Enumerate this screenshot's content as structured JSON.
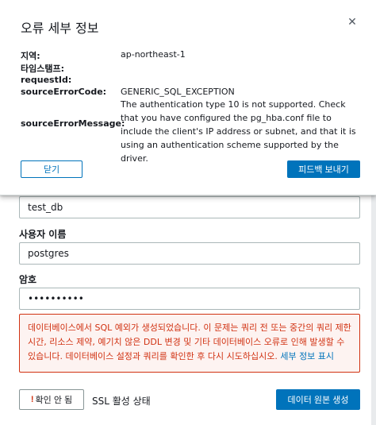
{
  "modal": {
    "title": "오류 세부 정보",
    "close_icon": "close-icon",
    "fields": [
      {
        "key": "지역:",
        "value": "ap-northeast-1"
      },
      {
        "key": "타임스탬프:",
        "value": ""
      },
      {
        "key": "requestId:",
        "value": ""
      },
      {
        "key": "sourceErrorCode:",
        "value": "GENERIC_SQL_EXCEPTION"
      },
      {
        "key": "sourceErrorMessage:",
        "value": "The authentication type 10 is not supported. Check that you have configured the pg_hba.conf file to include the client's IP address or subnet, and that it is using an authentication scheme supported by the driver."
      }
    ],
    "close_label": "닫기",
    "feedback_label": "피드백 보내기"
  },
  "form": {
    "database_value": "test_db",
    "username_label": "사용자 이름",
    "username_value": "postgres",
    "password_label": "암호",
    "password_value": "••••••••••"
  },
  "alert": {
    "message": "데이터베이스에서 SQL 예외가 생성되었습니다. 이 문제는 쿼리 전 또는 중간의 쿼리 제한 시간, 리소스 제약, 예기치 않은 DDL 변경 및 기타 데이터베이스 오류로 인해 발생할 수 있습니다. 데이터베이스 설정과 쿼리를 확인한 후 다시 시도하십시오.",
    "link_label": "세부 정보 표시"
  },
  "footer": {
    "status_warn": "!",
    "status_label": "확인 안 됨",
    "ssl_label": "SSL 활성 상태",
    "create_label": "데이터 원본 생성"
  },
  "colors": {
    "primary": "#0073bb",
    "error": "#d13212"
  }
}
